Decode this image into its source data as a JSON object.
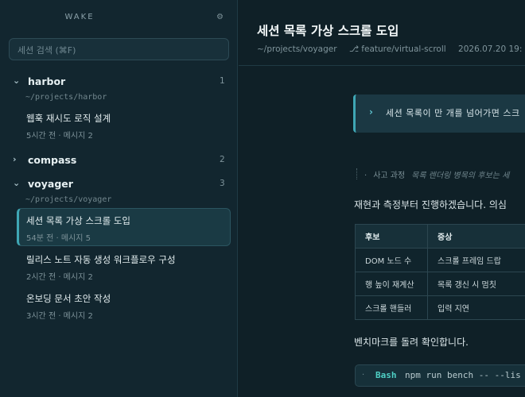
{
  "sidebar": {
    "brand": "WAKE",
    "gear_icon": "gear-icon",
    "search_placeholder": "세션 검색 (⌘F)",
    "projects": [
      {
        "name": "harbor",
        "count": "1",
        "expanded": true,
        "path": "~/projects/harbor",
        "sessions": [
          {
            "title": "웹훅 재시도 로직 설계",
            "meta": "5시간 전 · 메시지 2"
          }
        ]
      },
      {
        "name": "compass",
        "count": "2",
        "expanded": false
      },
      {
        "name": "voyager",
        "count": "3",
        "expanded": true,
        "path": "~/projects/voyager",
        "sessions": [
          {
            "title": "세션 목록 가상 스크롤 도입",
            "meta": "54분 전 · 메시지 5",
            "active": true
          },
          {
            "title": "릴리스 노트 자동 생성 워크플로우 구성",
            "meta": "2시간 전 · 메시지 2"
          },
          {
            "title": "온보딩 문서 초안 작성",
            "meta": "3시간 전 · 메시지 2"
          }
        ]
      }
    ]
  },
  "main": {
    "title": "세션 목록 가상 스크롤 도입",
    "meta": {
      "path": "~/projects/voyager",
      "branch": "⎇ feature/virtual-scroll",
      "timestamp": "2026.07.20 19:"
    },
    "callout": {
      "icon": "chevron-right-icon",
      "text": "세션 목록이 만 개를 넘어가면 스크"
    },
    "thought": {
      "label": "사고 과정",
      "summary": "목록 렌더링 병목의 후보는 세"
    },
    "intro": "재현과 측정부터 진행하겠습니다. 의심",
    "table": {
      "headers": [
        "후보",
        "증상"
      ],
      "rows": [
        [
          "DOM 노드 수",
          "스크롤 프레임 드랍"
        ],
        [
          "행 높이 재계산",
          "목록 갱신 시 멈칫"
        ],
        [
          "스크롤 핸들러",
          "입력 지연"
        ]
      ]
    },
    "bench_text": "벤치마크를 돌려 확인합니다.",
    "code": {
      "tool": "Bash",
      "command": "npm run bench -- --lis"
    }
  }
}
